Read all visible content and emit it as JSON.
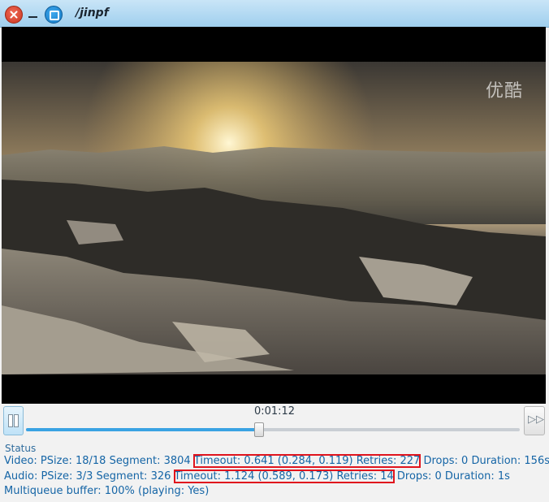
{
  "window": {
    "title": "/jinpf"
  },
  "video": {
    "watermark": "优酷"
  },
  "player": {
    "time": "0:01:12",
    "progress_fraction": 0.47
  },
  "status": {
    "heading": "Status",
    "video": {
      "prefix": "Video: PSize: 18/18 Segment: 3804 ",
      "highlight": "Timeout: 0.641 (0.284, 0.119) Retries: 227",
      "suffix": " Drops: 0 Duration: 156s"
    },
    "audio": {
      "prefix": "Audio: PSize: 3/3 Segment: 326 ",
      "highlight": "Timeout: 1.124 (0.589, 0.173) Retries: 14",
      "suffix": " Drops: 0 Duration: 1s"
    },
    "multiqueue": "Multiqueue buffer: 100% (playing: Yes)"
  }
}
